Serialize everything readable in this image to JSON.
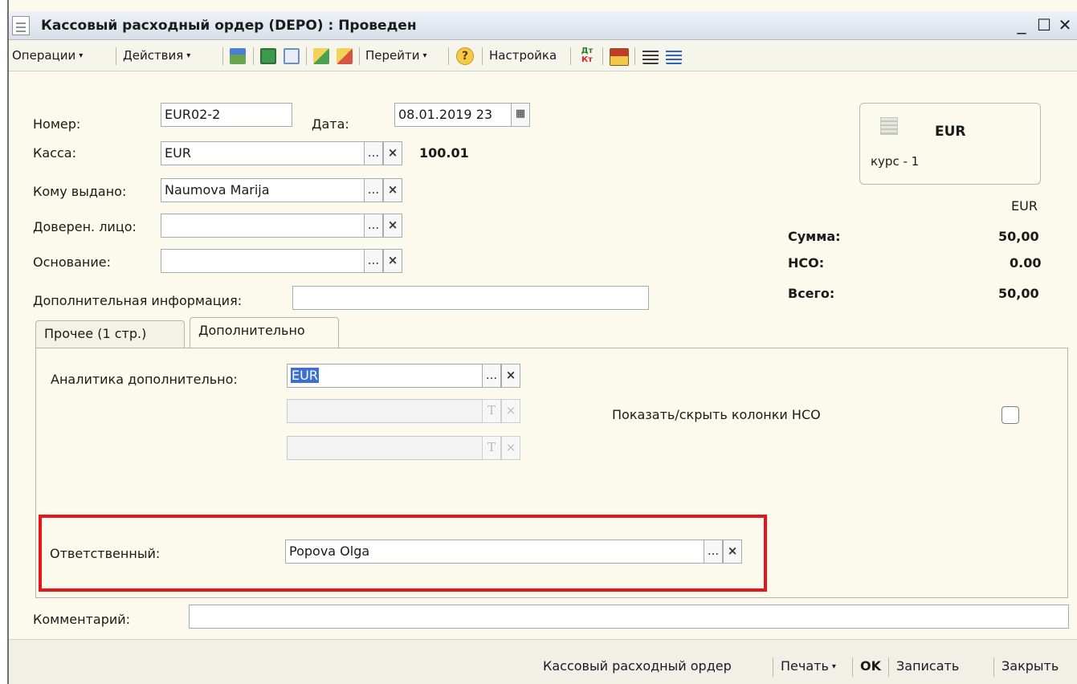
{
  "window": {
    "title": "Кассовый расходный ордер (DEPO) : Проведен",
    "minimize": "_",
    "maximize": "☐",
    "close": "✕"
  },
  "toolbar": {
    "operations": "Операции",
    "actions": "Действия",
    "goto": "Перейти",
    "help": "?",
    "settings": "Настройка",
    "dtkt_top": "Дт",
    "dtkt_bottom": "Кт",
    "icons": [
      "post-icon",
      "refresh-icon",
      "copy-icon",
      "fill-icon",
      "unfill-icon",
      "structure-icon",
      "list-icon",
      "columns-icon"
    ]
  },
  "form": {
    "number_label": "Номер:",
    "number_value": "EUR02-2",
    "date_label": "Дата:",
    "date_value": "08.01.2019 23",
    "cash_label": "Касса:",
    "cash_value": "EUR",
    "cash_account": "100.01",
    "issued_to_label": "Кому выдано:",
    "issued_to_value": "Naumova Marija",
    "trustee_label": "Доверен. лицо:",
    "trustee_value": "",
    "basis_label": "Основание:",
    "basis_value": "",
    "extra_info_label": "Дополнительная информация:",
    "extra_info_value": ""
  },
  "currency_box": {
    "code": "EUR",
    "rate": "курс - 1"
  },
  "summary": {
    "currency": "EUR",
    "sum_label": "Сумма:",
    "sum_value": "50,00",
    "vat_label": "НСО:",
    "vat_value": "0.00",
    "total_label": "Всего:",
    "total_value": "50,00"
  },
  "tabs": [
    {
      "label": "Прочее (1 стр.)",
      "active": false
    },
    {
      "label": "Дополнительно",
      "active": true
    }
  ],
  "additional": {
    "analytics_label": "Аналитика дополнительно:",
    "analytics_value": "EUR",
    "analytics_value2": "",
    "analytics_value3": "",
    "toggle_label": "Показать/скрыть колонки НСО",
    "toggle_checked": false,
    "responsible_label": "Ответственный:",
    "responsible_value": "Popova Olga"
  },
  "comment": {
    "label": "Комментарий:",
    "value": ""
  },
  "bottom": {
    "print_form": "Кассовый расходный ордер",
    "print": "Печать",
    "ok": "OK",
    "save": "Записать",
    "close": "Закрыть"
  },
  "glyphs": {
    "ellipsis": "...",
    "clear": "×",
    "type": "T",
    "calendar": "▦",
    "caret": "▾"
  },
  "colors": {
    "background": "#fbfaed",
    "highlight": "#e8161a",
    "selection": "#3b6fd1"
  }
}
